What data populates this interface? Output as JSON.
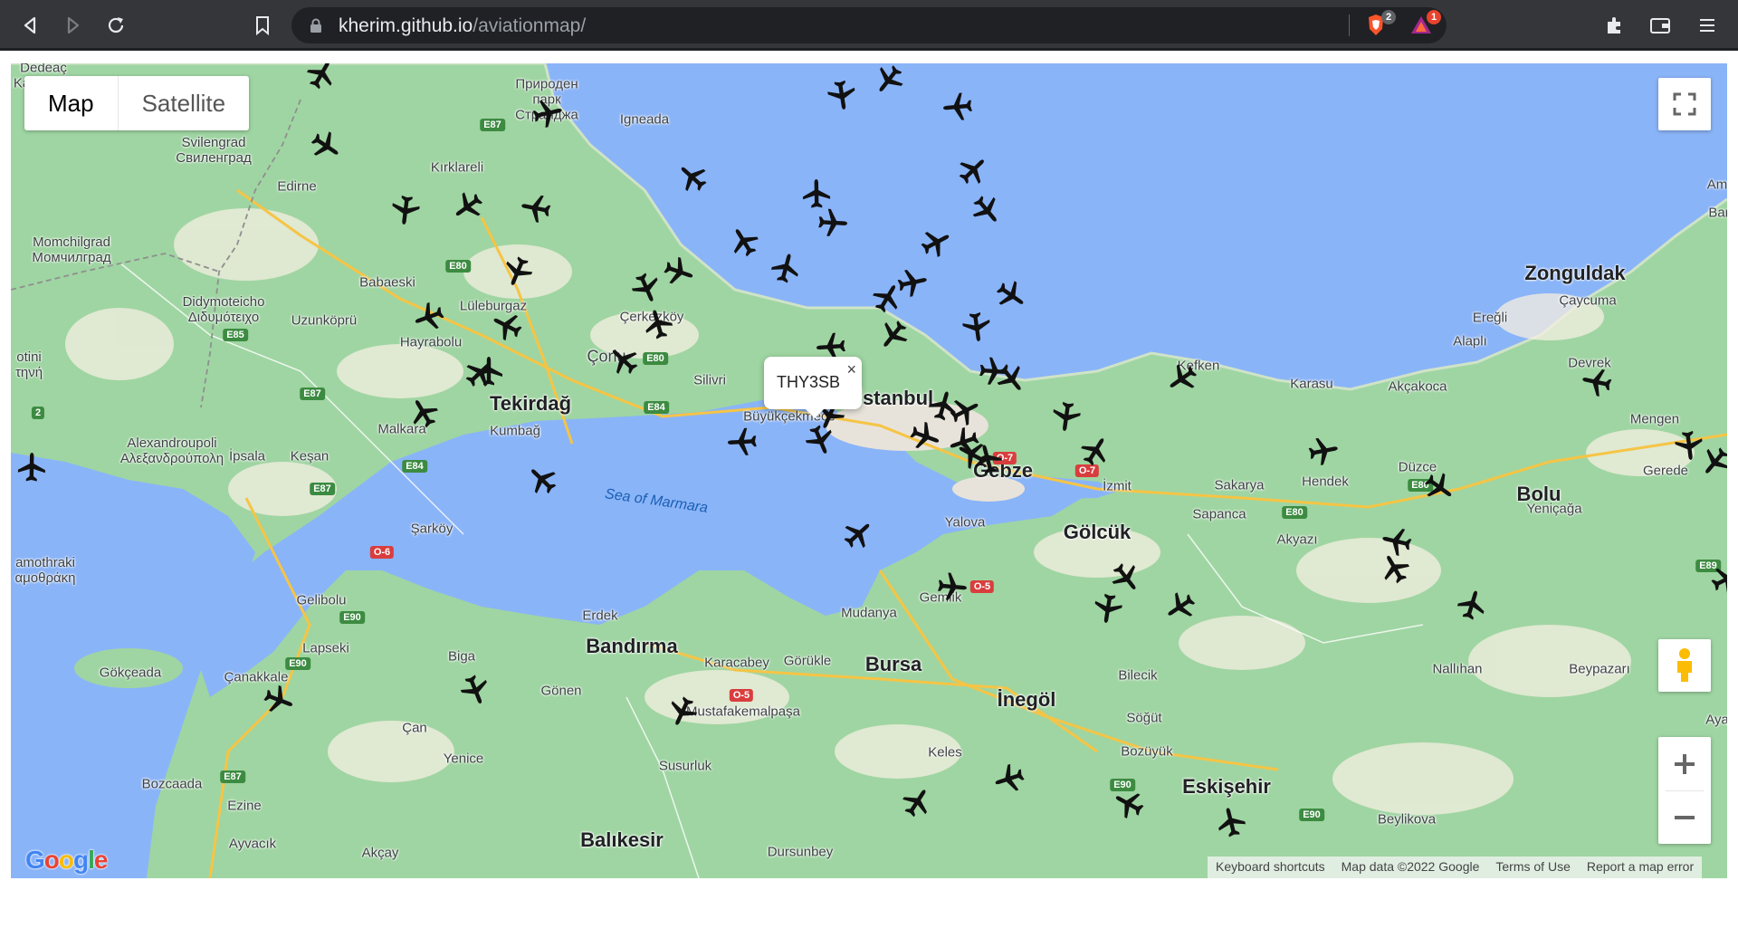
{
  "browser": {
    "url_domain": "kherim.github.io",
    "url_path": "/aviationmap/",
    "ext_badges": [
      "2",
      "1"
    ]
  },
  "map_controls": {
    "map_label": "Map",
    "satellite_label": "Satellite",
    "zoom_in": "+",
    "zoom_out": "−"
  },
  "infowindow": {
    "text": "THY3SB",
    "close": "×"
  },
  "footer": {
    "logo": "Google",
    "keyboard": "Keyboard shortcuts",
    "map_data": "Map data ©2022 Google",
    "terms": "Terms of Use",
    "report": "Report a map error"
  },
  "places": [
    {
      "t": "Ka",
      "c": "sm"
    },
    {
      "t": "Природен\nпарк\nСтранджа",
      "c": "sm"
    },
    {
      "t": "Igneada",
      "c": "sm"
    },
    {
      "t": "Svilengrad\nСвиленград",
      "c": "sm"
    },
    {
      "t": "Kırklareli",
      "c": "sm"
    },
    {
      "t": "Edirne",
      "c": "sm"
    },
    {
      "t": "Momchilgrad\nМомчилград",
      "c": "sm"
    },
    {
      "t": "Babaeski",
      "c": "sm"
    },
    {
      "t": "Lüleburgaz",
      "c": "sm"
    },
    {
      "t": "Çerkezköy",
      "c": "sm"
    },
    {
      "t": "Didymoteicho\nΔιδυμότειχο",
      "c": "sm"
    },
    {
      "t": "Uzunköprü",
      "c": "sm"
    },
    {
      "t": "Hayrabolu",
      "c": "sm"
    },
    {
      "t": "Çorlu",
      "c": "mid"
    },
    {
      "t": "Silivri",
      "c": "sm"
    },
    {
      "t": "Büyükçekmece",
      "c": "sm"
    },
    {
      "t": "İstanbul",
      "c": "big"
    },
    {
      "t": "Tekirdağ",
      "c": "big"
    },
    {
      "t": "Alexandroupoli\nΑλεξανδρούπολη",
      "c": "sm"
    },
    {
      "t": "İpsala",
      "c": "sm"
    },
    {
      "t": "Keşan",
      "c": "sm"
    },
    {
      "t": "Malkara",
      "c": "sm"
    },
    {
      "t": "Kumbağ",
      "c": "sm"
    },
    {
      "t": "Sea of Marmara",
      "c": "sea"
    },
    {
      "t": "Şarköy",
      "c": "sm"
    },
    {
      "t": "amothraki\nαμοθράκη",
      "c": "sm"
    },
    {
      "t": "Gelibolu",
      "c": "sm"
    },
    {
      "t": "Lapseki",
      "c": "sm"
    },
    {
      "t": "Gökçeada",
      "c": "sm"
    },
    {
      "t": "Çanakkale",
      "c": "sm"
    },
    {
      "t": "Erdek",
      "c": "sm"
    },
    {
      "t": "Bandırma",
      "c": "big"
    },
    {
      "t": "Biga",
      "c": "sm"
    },
    {
      "t": "Karacabey",
      "c": "sm"
    },
    {
      "t": "Görükle",
      "c": "sm"
    },
    {
      "t": "Bursa",
      "c": "big"
    },
    {
      "t": "Gönen",
      "c": "sm"
    },
    {
      "t": "Çan",
      "c": "sm"
    },
    {
      "t": "Mustafakemalpaşa",
      "c": "sm"
    },
    {
      "t": "Yenice",
      "c": "sm"
    },
    {
      "t": "Susurluk",
      "c": "sm"
    },
    {
      "t": "Bozcaada",
      "c": "sm"
    },
    {
      "t": "Ezine",
      "c": "sm"
    },
    {
      "t": "Ayvacık",
      "c": "sm"
    },
    {
      "t": "Akçay",
      "c": "sm"
    },
    {
      "t": "Balıkesir",
      "c": "big"
    },
    {
      "t": "Dursunbey",
      "c": "sm"
    },
    {
      "t": "Mudanya",
      "c": "sm"
    },
    {
      "t": "Gemlik",
      "c": "sm"
    },
    {
      "t": "Yalova",
      "c": "sm"
    },
    {
      "t": "Gebze",
      "c": "big"
    },
    {
      "t": "İzmit",
      "c": "sm"
    },
    {
      "t": "Gölcük",
      "c": "big"
    },
    {
      "t": "Sapanca",
      "c": "sm"
    },
    {
      "t": "Sakarya",
      "c": "sm"
    },
    {
      "t": "Kefken",
      "c": "sm"
    },
    {
      "t": "Karasu",
      "c": "sm"
    },
    {
      "t": "Akçakoca",
      "c": "sm"
    },
    {
      "t": "Hendek",
      "c": "sm"
    },
    {
      "t": "Akyazı",
      "c": "sm"
    },
    {
      "t": "Düzce",
      "c": "sm"
    },
    {
      "t": "Bolu",
      "c": "big"
    },
    {
      "t": "Yeniçağa",
      "c": "sm"
    },
    {
      "t": "Gerede",
      "c": "sm"
    },
    {
      "t": "Mengen",
      "c": "sm"
    },
    {
      "t": "Devrek",
      "c": "sm"
    },
    {
      "t": "Alaplı",
      "c": "sm"
    },
    {
      "t": "Ereğli",
      "c": "sm"
    },
    {
      "t": "Zonguldak",
      "c": "big"
    },
    {
      "t": "Çaycuma",
      "c": "sm"
    },
    {
      "t": "Bar",
      "c": "sm"
    },
    {
      "t": "Am",
      "c": "sm"
    },
    {
      "t": "İnegöl",
      "c": "big"
    },
    {
      "t": "Bilecik",
      "c": "sm"
    },
    {
      "t": "Söğüt",
      "c": "sm"
    },
    {
      "t": "Bozüyük",
      "c": "sm"
    },
    {
      "t": "Keles",
      "c": "sm"
    },
    {
      "t": "Eskişehir",
      "c": "big"
    },
    {
      "t": "Beylikova",
      "c": "sm"
    },
    {
      "t": "Nallıhan",
      "c": "sm"
    },
    {
      "t": "Beypazarı",
      "c": "sm"
    },
    {
      "t": "Aya",
      "c": "sm"
    },
    {
      "t": "otini\nτηνή",
      "c": "sm"
    },
    {
      "t": "Dedeaç",
      "c": "sm"
    }
  ],
  "shields": [
    {
      "t": "E87",
      "k": "e"
    },
    {
      "t": "E80",
      "k": "e"
    },
    {
      "t": "E85",
      "k": "e"
    },
    {
      "t": "E87",
      "k": "e"
    },
    {
      "t": "E80",
      "k": "e"
    },
    {
      "t": "E84",
      "k": "e"
    },
    {
      "t": "E84",
      "k": "e"
    },
    {
      "t": "E87",
      "k": "e"
    },
    {
      "t": "O-6",
      "k": "o"
    },
    {
      "t": "E90",
      "k": "e"
    },
    {
      "t": "E90",
      "k": "e"
    },
    {
      "t": "E87",
      "k": "e"
    },
    {
      "t": "O-5",
      "k": "o"
    },
    {
      "t": "O-5",
      "k": "o"
    },
    {
      "t": "O-7",
      "k": "o"
    },
    {
      "t": "O-7",
      "k": "o"
    },
    {
      "t": "E80",
      "k": "e"
    },
    {
      "t": "E80",
      "k": "e"
    },
    {
      "t": "E90",
      "k": "e"
    },
    {
      "t": "E90",
      "k": "e"
    },
    {
      "t": "E89",
      "k": "e"
    },
    {
      "t": "2",
      "k": "e"
    }
  ]
}
